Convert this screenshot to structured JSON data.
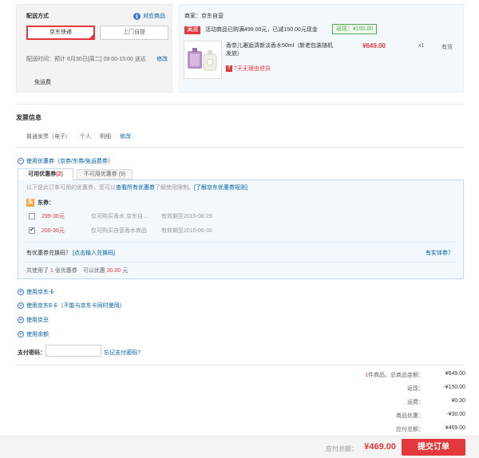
{
  "delivery": {
    "title": "配送方式",
    "compare_link": "对应商品",
    "express_label": "京东快递",
    "pickup_label": "上门自提",
    "time_text": "配送时间：预计 6月30日[周二] 09:00-15:00 送达",
    "edit_label": "修改",
    "free_shipping": "免运费"
  },
  "seller": {
    "name": "商家：京东自营",
    "promo_tag": "满减",
    "promo_text": "活动商品已购满499.00元，已减150.00元现金",
    "saved_badge": "返现：¥150.00",
    "product_name": "香奈儿邂逅清新淡香水50ml（新老包装随机发放）",
    "return_policy": "7天无理由退货",
    "price": "¥649.00",
    "qty": "x1",
    "stock": "有货"
  },
  "invoice": {
    "title": "发票信息",
    "type": "普通发票（电子）",
    "holder": "个人",
    "detail": "明细",
    "edit_label": "修改"
  },
  "coupons": {
    "toggle_label": "使用优惠券（京券/东券/免运费券）",
    "tab_usable_label": "可用优惠券",
    "tab_usable_count": "(2)",
    "tab_unusable_label": "不可用优惠券 (9)",
    "note_prefix": "以下是此订单可用的优惠券，您可以",
    "note_link1": "查看所有优惠券",
    "note_mid": "了解使用限制。",
    "note_link2": "[了解京东优惠券规则]",
    "dong_tag": "东",
    "dong_label": "东券：",
    "items": [
      {
        "amount": "299-30元",
        "desc": "仅可购买香水 京东自...",
        "expiry": "有效期至2015-06-29",
        "checked": ""
      },
      {
        "amount": "200-30元",
        "desc": "仅可购买自营香水商品",
        "expiry": "有效期至2015-06-30",
        "checked": "✔"
      }
    ],
    "redeem_question": "有优惠券兑换码？",
    "redeem_link": "[点击输入兑换码]",
    "got_coupon_link": "有实体券？",
    "summary_prefix": "共使用了",
    "summary_count": "1",
    "summary_mid": "张优惠券　可以优惠",
    "summary_amount": "30.00",
    "summary_suffix": "元"
  },
  "options": {
    "jdcard": "使用京东卡",
    "ecard": "使用京东E卡（不能与京东卡同时使用）",
    "beans": "使用京豆",
    "balance": "使用余额"
  },
  "payment": {
    "password_label": "支付密码：",
    "forgot_link": "忘记支付密码?"
  },
  "summary": {
    "total_count": "1",
    "total_label": "件商品，总商品金额：",
    "total_value": "¥649.00",
    "back_label": "返现：",
    "back_value": "-¥150.00",
    "ship_label": "运费：",
    "ship_value": "¥0.00",
    "disc_label": "商品优惠：",
    "disc_value": "-¥30.00",
    "pay_label": "应付总额：",
    "pay_value": "¥469.00"
  },
  "footer": {
    "label": "应付总额：",
    "amount": "¥469.00",
    "submit_label": "提交订单"
  }
}
